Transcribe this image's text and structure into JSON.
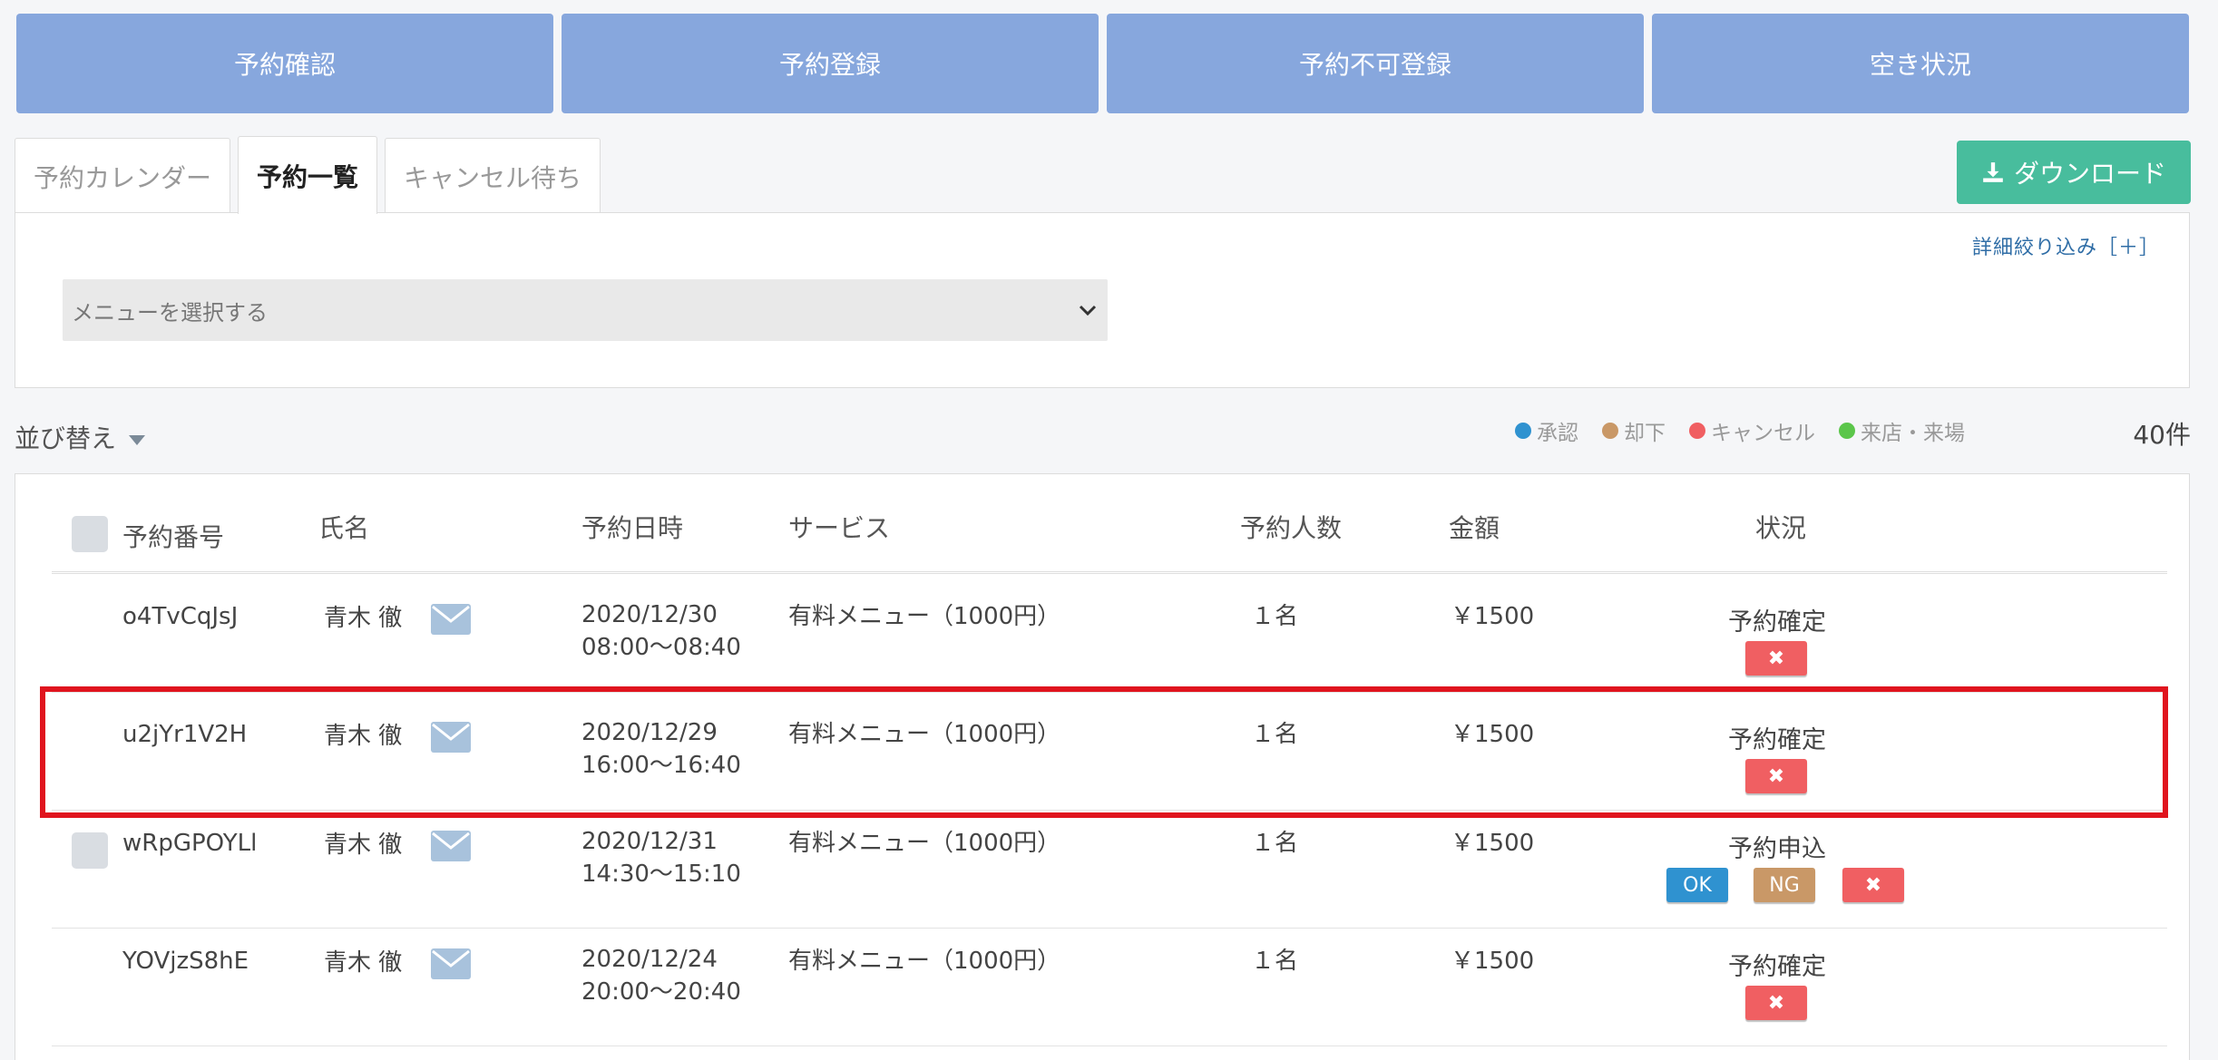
{
  "top_nav": [
    "予約確認",
    "予約登録",
    "予約不可登録",
    "空き状況"
  ],
  "tabs": [
    "予約カレンダー",
    "予約一覧",
    "キャンセル待ち"
  ],
  "download_label": "ダウンロード",
  "filter": {
    "detail_link": "詳細絞り込み［＋］",
    "menu_select_value": "メニューを選択する"
  },
  "sort_label": "並び替え",
  "legend": [
    {
      "label": "承認",
      "color": "#2f92d0"
    },
    {
      "label": "却下",
      "color": "#c99867"
    },
    {
      "label": "キャンセル",
      "color": "#f05f62"
    },
    {
      "label": "来店・来場",
      "color": "#5bc64a"
    }
  ],
  "count": "40件",
  "columns": [
    "予約番号",
    "氏名",
    "予約日時",
    "サービス",
    "予約人数",
    "金額",
    "状況"
  ],
  "rows": [
    {
      "id": "o4TvCqJsJ",
      "name": "青木 徹",
      "date": "2020/12/30",
      "time": "08:00〜08:40",
      "service": "有料メニュー（1000円）",
      "people": "１名",
      "price": "￥1500",
      "status": "予約確定"
    },
    {
      "id": "u2jYr1V2H",
      "name": "青木 徹",
      "date": "2020/12/29",
      "time": "16:00〜16:40",
      "service": "有料メニュー（1000円）",
      "people": "１名",
      "price": "￥1500",
      "status": "予約確定"
    },
    {
      "id": "wRpGPOYLl",
      "name": "青木 徹",
      "date": "2020/12/31",
      "time": "14:30〜15:10",
      "service": "有料メニュー（1000円）",
      "people": "１名",
      "price": "￥1500",
      "status": "予約申込"
    },
    {
      "id": "YOVjzS8hE",
      "name": "青木 徹",
      "date": "2020/12/24",
      "time": "20:00〜20:40",
      "service": "有料メニュー（1000円）",
      "people": "１名",
      "price": "￥1500",
      "status": "予約確定"
    }
  ],
  "action_buttons": {
    "ok": "OK",
    "ng": "NG",
    "cancel": "✖"
  },
  "colors": {
    "nav": "#87a7dd",
    "download": "#48bd9d",
    "highlight": "#e0141e"
  }
}
